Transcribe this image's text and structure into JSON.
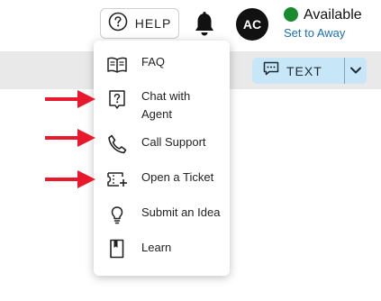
{
  "header": {
    "help_label": "HELP",
    "avatar_initials": "AC",
    "presence_status": "Available",
    "presence_color": "#1a8a2e",
    "set_away_label": "Set to Away"
  },
  "toolbar": {
    "text_button_label": "TEXT",
    "text_button_color": "#c7e6f7"
  },
  "help_menu": {
    "items": [
      {
        "label": "FAQ",
        "icon": "book-icon"
      },
      {
        "label": "Chat with Agent",
        "icon": "chat-question-icon"
      },
      {
        "label": "Call Support",
        "icon": "phone-icon"
      },
      {
        "label": "Open a Ticket",
        "icon": "ticket-plus-icon"
      },
      {
        "label": "Submit an Idea",
        "icon": "lightbulb-icon"
      },
      {
        "label": "Learn",
        "icon": "bookmark-book-icon"
      }
    ]
  },
  "annotation_arrow_color": "#e8192c"
}
